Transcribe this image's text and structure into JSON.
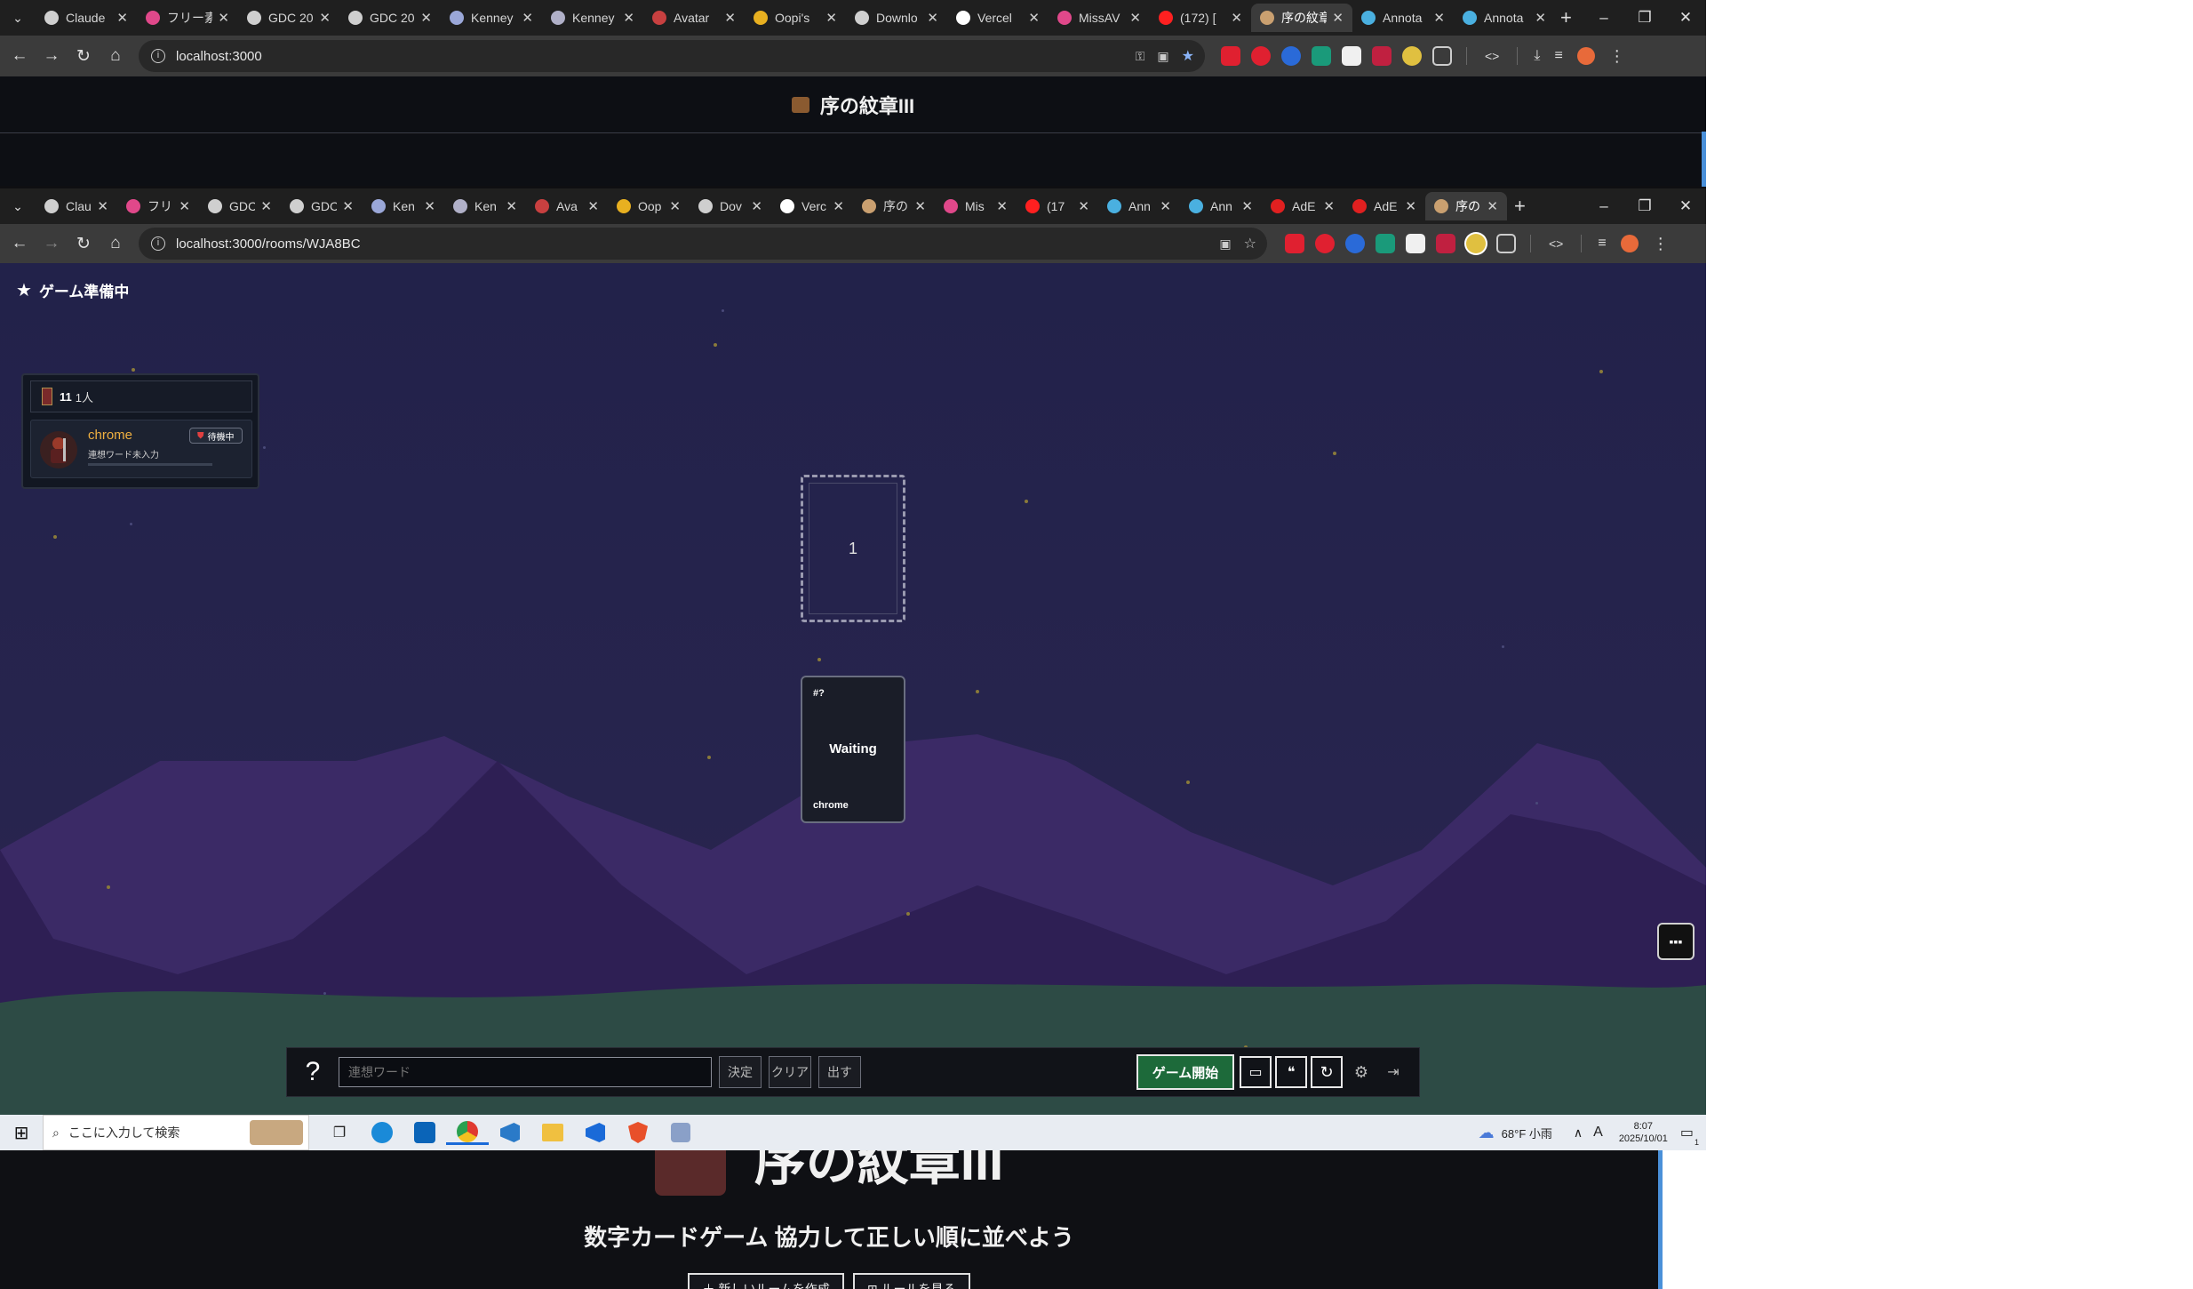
{
  "outer_browser": {
    "tabs": [
      {
        "label": "Claude",
        "color": "#cfcfcf"
      },
      {
        "label": "フリー素",
        "color": "#e0488a"
      },
      {
        "label": "GDC 20",
        "color": "#cfcfcf"
      },
      {
        "label": "GDC 20",
        "color": "#cfcfcf"
      },
      {
        "label": "Kenney",
        "color": "#9aa7d8"
      },
      {
        "label": "Kenney",
        "color": "#b0b0c8"
      },
      {
        "label": "Avatar",
        "color": "#c84040"
      },
      {
        "label": "Oopi's",
        "color": "#e8b020"
      },
      {
        "label": "Downlo",
        "color": "#cfcfcf"
      },
      {
        "label": "Vercel",
        "color": "#ffffff"
      },
      {
        "label": "MissAV",
        "color": "#e0488a"
      },
      {
        "label": "(172) [",
        "color": "#ff2020"
      },
      {
        "label": "序の紋章",
        "color": "#caa070",
        "active": true
      },
      {
        "label": "Annota",
        "color": "#4ab0e0"
      },
      {
        "label": "Annota",
        "color": "#4ab0e0"
      }
    ],
    "url": "localhost:3000",
    "page_title": "序の紋章III",
    "home_title_partial": "序の紋章III",
    "home_subtitle": "数字カードゲーム 協力して正しい順に並べよう",
    "home_button_1": "＋ 新しいルームを作成",
    "home_button_2": "⊞ ルールを見る"
  },
  "inner_browser": {
    "tabs": [
      {
        "label": "Clau",
        "color": "#cfcfcf"
      },
      {
        "label": "フリ",
        "color": "#e0488a"
      },
      {
        "label": "GDC",
        "color": "#cfcfcf"
      },
      {
        "label": "GDC",
        "color": "#cfcfcf"
      },
      {
        "label": "Ken",
        "color": "#9aa7d8"
      },
      {
        "label": "Ken",
        "color": "#b0b0c8"
      },
      {
        "label": "Ava",
        "color": "#c84040"
      },
      {
        "label": "Oop",
        "color": "#e8b020"
      },
      {
        "label": "Dov",
        "color": "#cfcfcf"
      },
      {
        "label": "Verc",
        "color": "#ffffff"
      },
      {
        "label": "序の",
        "color": "#caa070"
      },
      {
        "label": "Mis",
        "color": "#e0488a"
      },
      {
        "label": "(17",
        "color": "#ff2020"
      },
      {
        "label": "Ann",
        "color": "#4ab0e0"
      },
      {
        "label": "Ann",
        "color": "#4ab0e0"
      },
      {
        "label": "AdE",
        "color": "#e02020"
      },
      {
        "label": "AdE",
        "color": "#e02020"
      },
      {
        "label": "序の",
        "color": "#caa070",
        "active": true
      }
    ],
    "url": "localhost:3000/rooms/WJA8BC"
  },
  "game": {
    "status_label": "ゲーム準備中",
    "player_panel": {
      "count_number": "11",
      "count_label": "1人",
      "player_name": "chrome",
      "player_status": "連想ワード未入力",
      "badge": "待機中"
    },
    "slot_number": "1",
    "card": {
      "corner": "#?",
      "state": "Waiting",
      "owner": "chrome"
    },
    "toolbar": {
      "help": "?",
      "input_placeholder": "連想ワード",
      "decide": "決定",
      "clear": "クリア",
      "submit": "出す",
      "start": "ゲーム開始"
    }
  },
  "taskbar": {
    "search_placeholder": "ここに入力して検索",
    "weather": "68°F 小雨",
    "ime": "A",
    "time": "8:07",
    "date": "2025/10/01",
    "notification_count": "1"
  }
}
